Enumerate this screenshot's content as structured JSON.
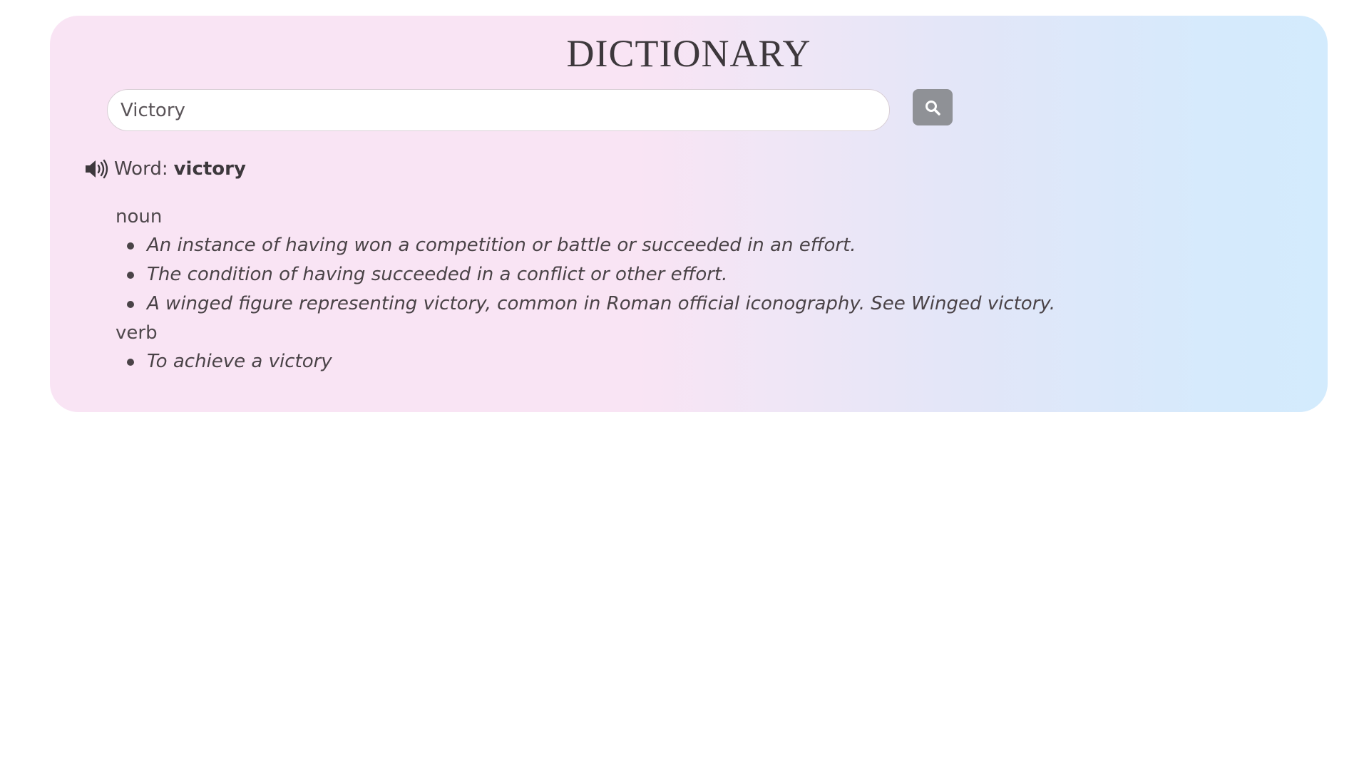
{
  "header": {
    "title": "DICTIONARY"
  },
  "search": {
    "value": "Victory",
    "button_icon": "search-icon"
  },
  "result": {
    "speaker_icon": "speaker-icon",
    "word_label": "Word:",
    "word": "victory",
    "meanings": [
      {
        "part_of_speech": "noun",
        "definitions": [
          "An instance of having won a competition or battle or succeeded in an effort.",
          "The condition of having succeeded in a conflict or other effort.",
          "A winged figure representing victory, common in Roman official iconography. See Winged victory."
        ]
      },
      {
        "part_of_speech": "verb",
        "definitions": [
          "To achieve a victory"
        ]
      }
    ]
  },
  "colors": {
    "gradient_start": "#f9e4f4",
    "gradient_end": "#d3ebfd",
    "button": "#8f9196",
    "text": "#4a4347"
  }
}
